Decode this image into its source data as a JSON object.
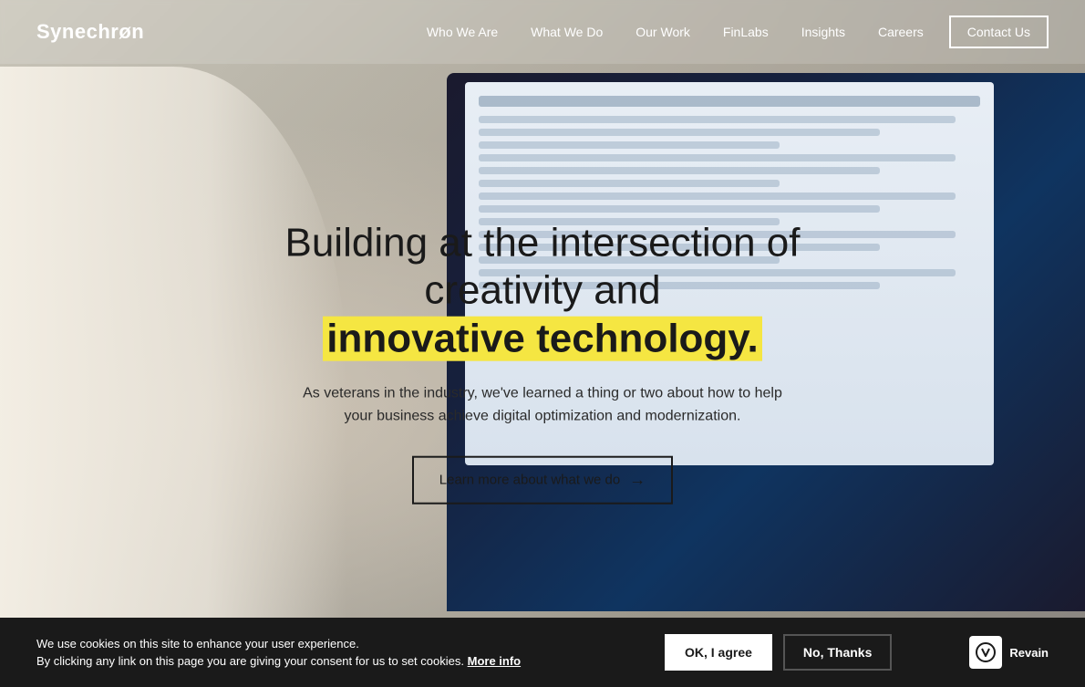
{
  "brand": {
    "name": "Synechron",
    "logo_text": "Synechrøn"
  },
  "nav": {
    "links": [
      {
        "id": "who-we-are",
        "label": "Who We Are"
      },
      {
        "id": "what-we-do",
        "label": "What We Do"
      },
      {
        "id": "our-work",
        "label": "Our Work"
      },
      {
        "id": "finlabs",
        "label": "FinLabs"
      },
      {
        "id": "insights",
        "label": "Insights"
      },
      {
        "id": "careers",
        "label": "Careers"
      }
    ],
    "contact_label": "Contact Us"
  },
  "hero": {
    "title_line1": "Building at the intersection of creativity and",
    "title_line2": "innovative technology.",
    "subtitle": "As veterans in the industry, we've learned a thing or two about how to help your business achieve digital optimization and modernization.",
    "cta_label": "Learn more about what we do",
    "cta_arrow": "→"
  },
  "cookie": {
    "message_line1": "We use cookies on this site to enhance your user experience.",
    "message_line2": "By clicking any link on this page you are giving your consent for us to set cookies.",
    "more_info_label": "More info",
    "agree_label": "OK, I agree",
    "decline_label": "No, Thanks"
  },
  "revain": {
    "icon": "⌥",
    "label": "Revain"
  },
  "colors": {
    "highlight_yellow": "#f5e642",
    "dark": "#1a1a1a",
    "white": "#ffffff",
    "border": "#555555"
  }
}
